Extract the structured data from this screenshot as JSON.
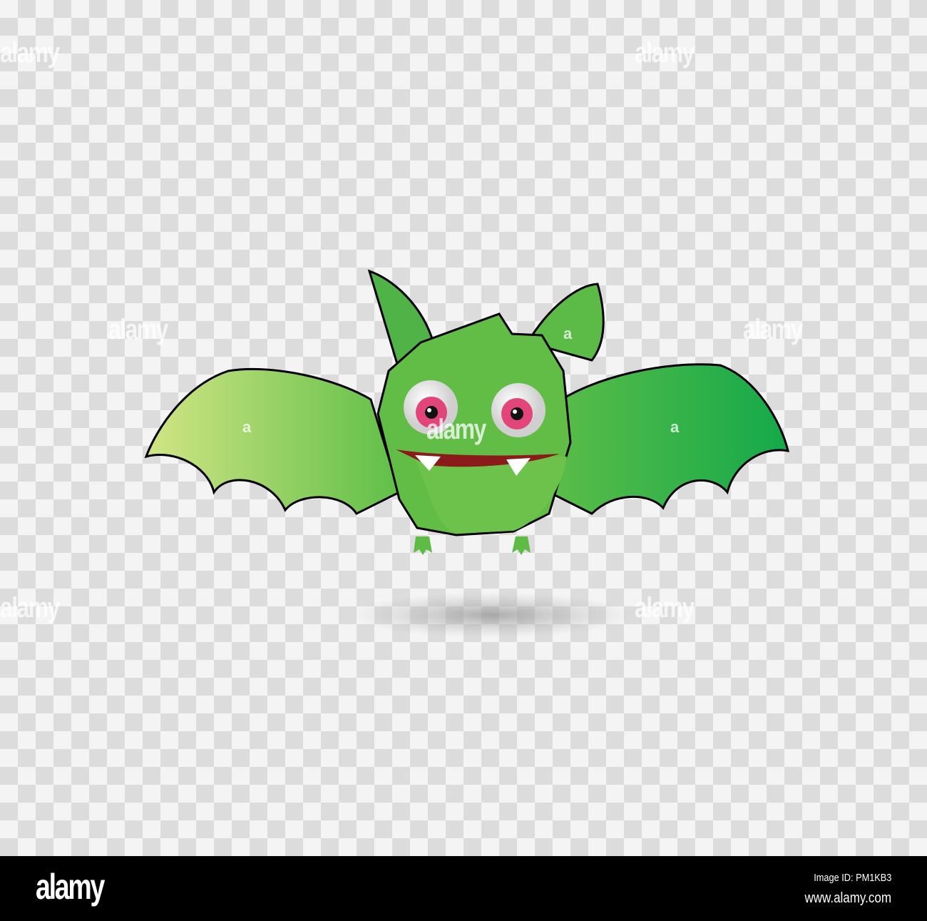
{
  "image": {
    "subject": "green cartoon bat",
    "watermark_text": "alamy",
    "watermark_letter": "a",
    "colors": {
      "body": "#5dbb46",
      "wing_left": "#c6e07a",
      "wing_right": "#1fae4a",
      "iris": "#e2457a",
      "mouth": "#8b1a1a",
      "outline": "#000000"
    }
  },
  "footer": {
    "logo": "alamy",
    "image_id": "Image ID: PM1KB3",
    "url": "www.alamy.com"
  }
}
